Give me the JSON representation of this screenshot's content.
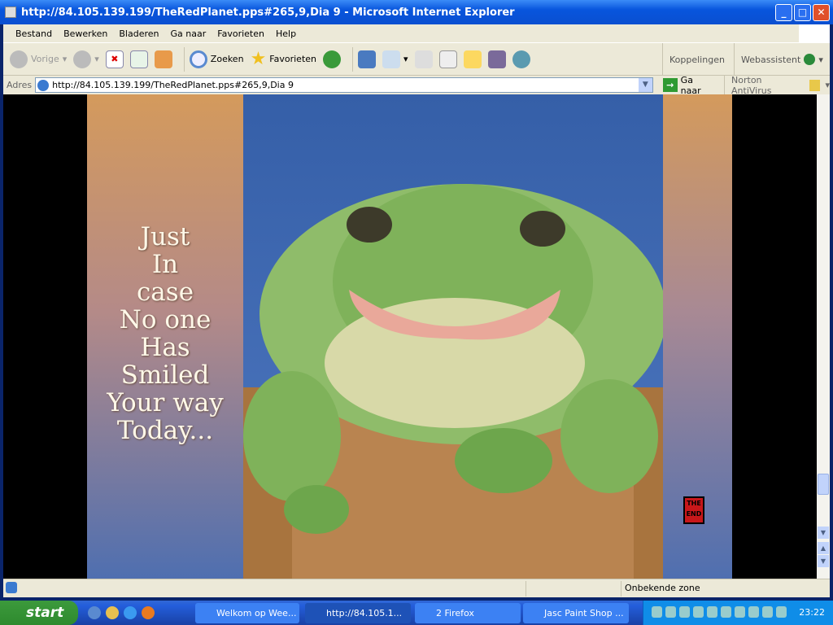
{
  "window": {
    "title": "http://84.105.139.199/TheRedPlanet.pps#265,9,Dia 9 - Microsoft Internet Explorer"
  },
  "menu": [
    "Bestand",
    "Bewerken",
    "Bladeren",
    "Ga naar",
    "Favorieten",
    "Help"
  ],
  "toolbar": {
    "back": "Vorige",
    "search": "Zoeken",
    "favorites": "Favorieten",
    "links": "Koppelingen",
    "webassistant": "Webassistent"
  },
  "address": {
    "label": "Adres",
    "value": "http://84.105.139.199/TheRedPlanet.pps#265,9,Dia 9",
    "go": "Ga naar",
    "norton": "Norton AntiVirus"
  },
  "slide": {
    "lines": [
      "Just",
      "In",
      "case",
      "No one",
      "Has",
      "Smiled",
      "Your way",
      "Today..."
    ],
    "badge": "THE END"
  },
  "status": {
    "zone": "Onbekende zone"
  },
  "taskbar": {
    "start": "start",
    "tasks": [
      "Welkom op Wee...",
      "http://84.105.1...",
      "2 Firefox",
      "Jasc Paint Shop ..."
    ],
    "clock": "23:22"
  }
}
